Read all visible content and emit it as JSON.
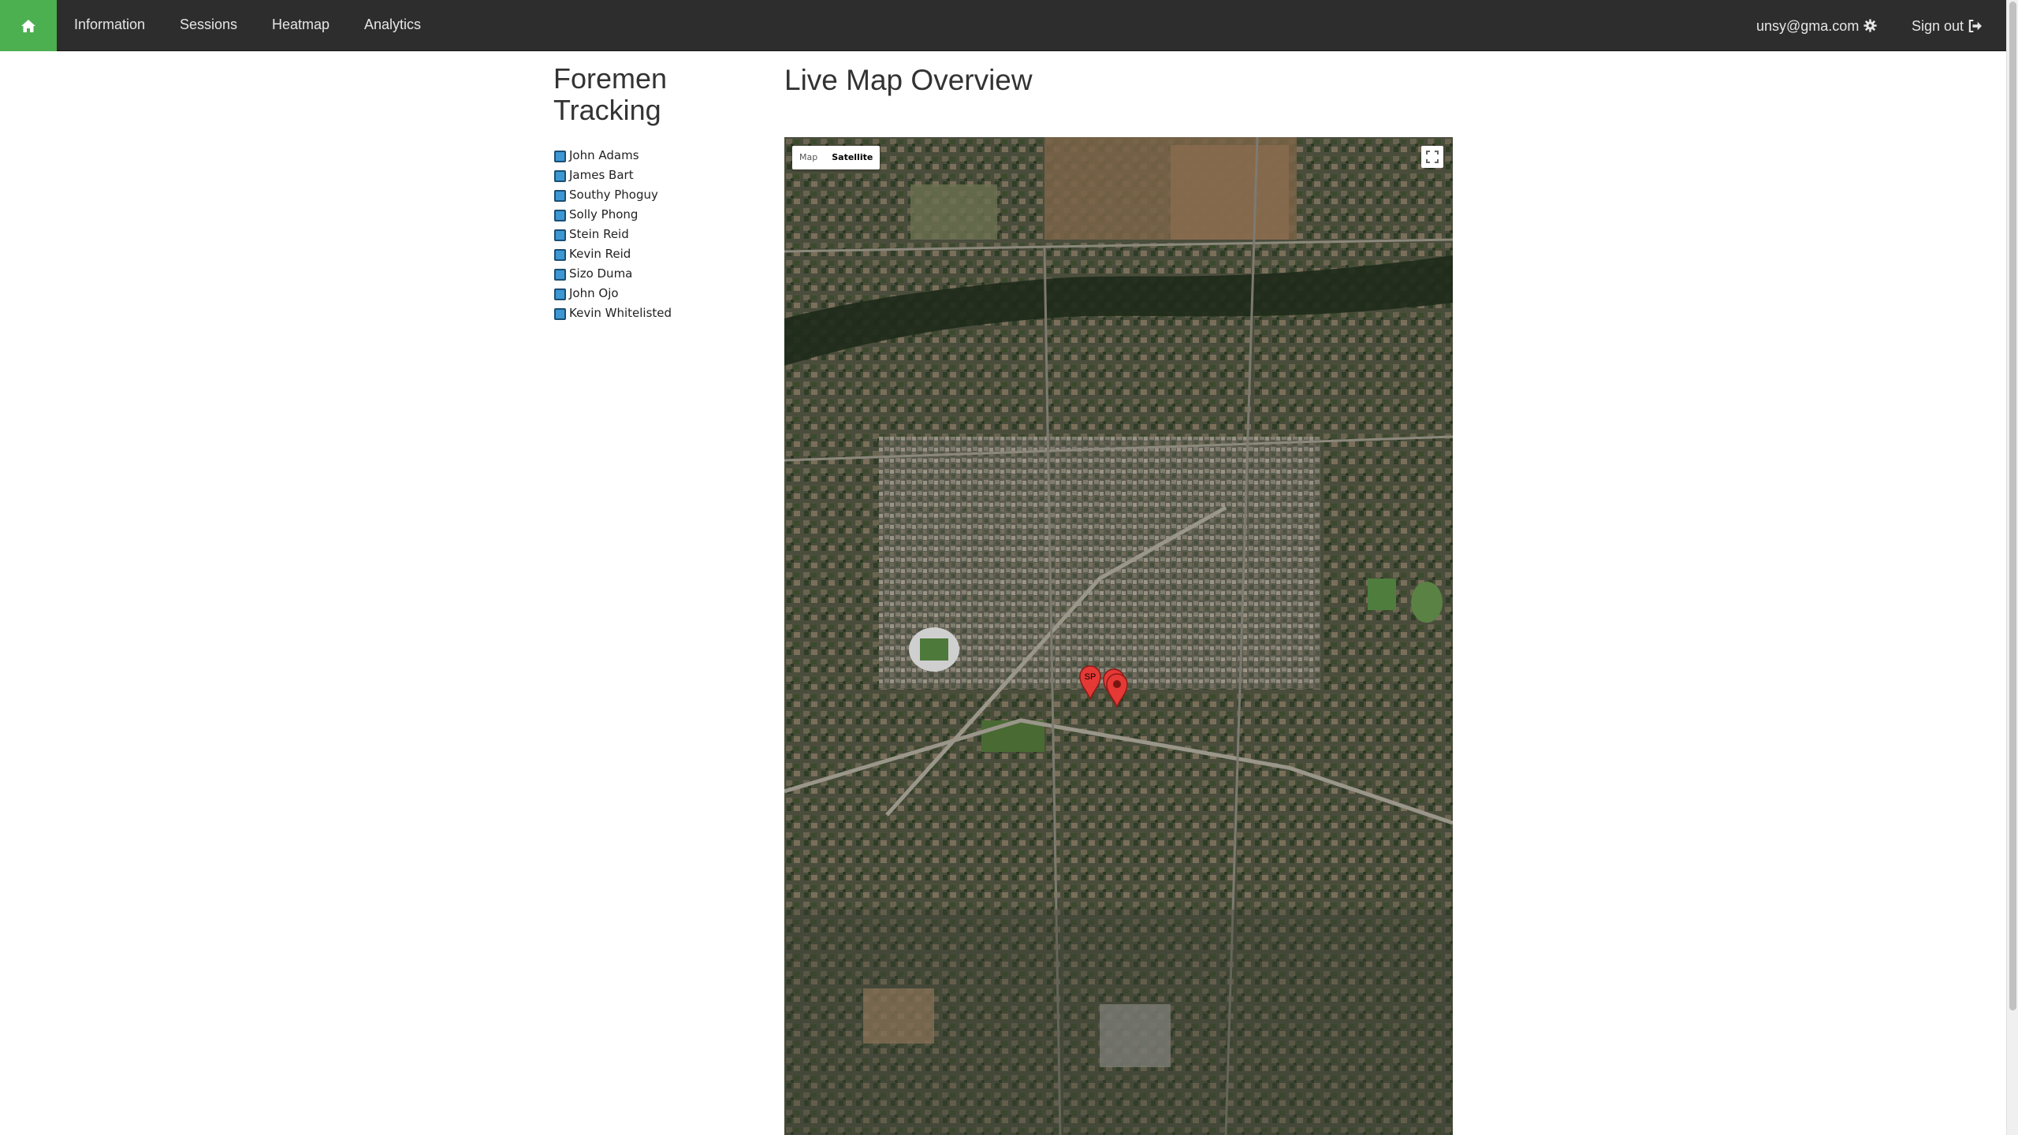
{
  "nav": {
    "home_icon": "home-icon",
    "links": [
      {
        "label": "Information"
      },
      {
        "label": "Sessions"
      },
      {
        "label": "Heatmap"
      },
      {
        "label": "Analytics"
      }
    ],
    "user_email": "unsy@gma.com",
    "settings_icon": "gear-icon",
    "sign_out_label": "Sign out",
    "sign_out_icon": "sign-out-icon",
    "accent_color": "#4caf50"
  },
  "sidebar": {
    "title": "Foremen Tracking",
    "foremen": [
      {
        "name": "John Adams",
        "checked": true
      },
      {
        "name": "James Bart",
        "checked": true
      },
      {
        "name": "Southy Phoguy",
        "checked": true
      },
      {
        "name": "Solly Phong",
        "checked": true
      },
      {
        "name": "Stein Reid",
        "checked": true
      },
      {
        "name": "Kevin Reid",
        "checked": true
      },
      {
        "name": "Sizo Duma",
        "checked": true
      },
      {
        "name": "John Ojo",
        "checked": true
      },
      {
        "name": "Kevin Whitelisted",
        "checked": true
      }
    ]
  },
  "main": {
    "title": "Live Map Overview",
    "map": {
      "type_buttons": [
        {
          "label": "Map",
          "active": false
        },
        {
          "label": "Satellite",
          "active": true
        }
      ],
      "fullscreen_icon": "fullscreen-icon",
      "markers": [
        {
          "label": "SP",
          "color": "#e53935"
        },
        {
          "label": "",
          "color": "#e53935"
        },
        {
          "label": "",
          "color": "#e53935"
        }
      ]
    }
  }
}
